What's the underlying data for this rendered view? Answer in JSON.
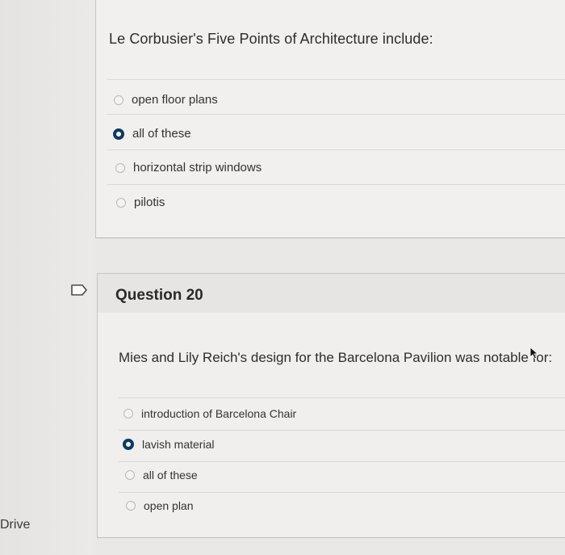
{
  "sidebar": {
    "drive_label": "Drive"
  },
  "question19": {
    "text": "Le Corbusier's Five Points of Architecture include:",
    "options": [
      {
        "label": "open floor plans",
        "selected": false
      },
      {
        "label": "all of these",
        "selected": true
      },
      {
        "label": "horizontal strip windows",
        "selected": false
      },
      {
        "label": "pilotis",
        "selected": false
      }
    ]
  },
  "question20": {
    "title": "Question 20",
    "flag_icon": "flag-icon",
    "text": "Mies and Lily Reich's design for the Barcelona Pavilion was notable for:",
    "options": [
      {
        "label": "introduction of Barcelona Chair",
        "selected": false
      },
      {
        "label": "lavish material",
        "selected": true
      },
      {
        "label": "all of these",
        "selected": false
      },
      {
        "label": "open plan",
        "selected": false
      }
    ]
  },
  "colors": {
    "selected_radio": "#0a3a64",
    "background": "#e9e8e6"
  }
}
